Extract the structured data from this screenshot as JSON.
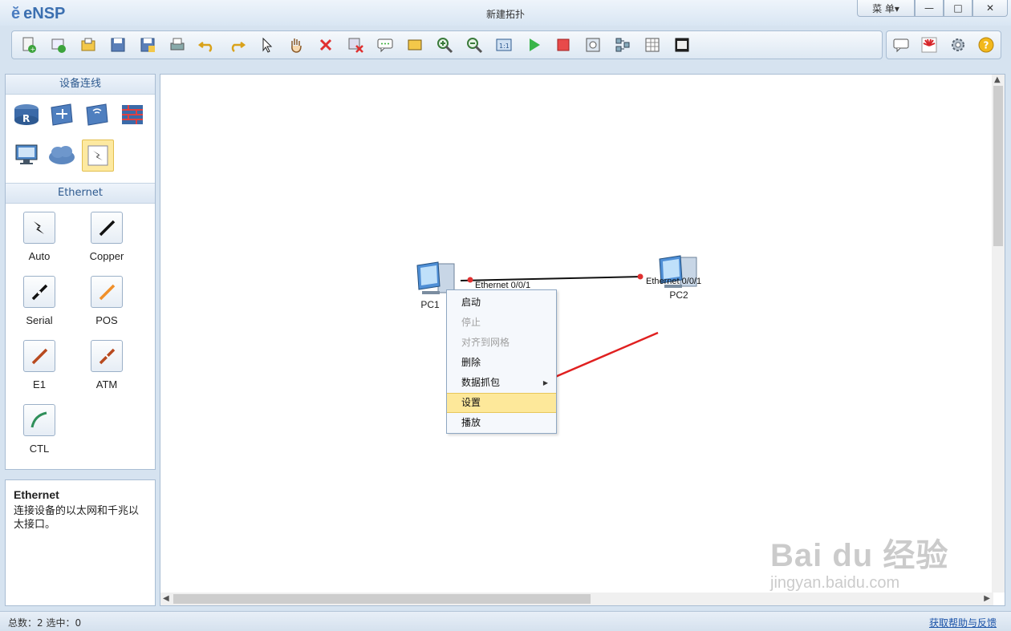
{
  "window": {
    "app_name": "eNSP",
    "title": "新建拓扑",
    "menu_label": "菜 单▾",
    "minimize": "—",
    "maximize": "□",
    "close": "✕"
  },
  "toolbar": {
    "icons": [
      "new-topology-icon",
      "new-example-icon",
      "open-icon",
      "save-icon",
      "save-as-icon",
      "print-icon",
      "undo-icon",
      "redo-icon",
      "select-icon",
      "pan-hand-icon",
      "delete-icon",
      "delete-link-icon",
      "text-annotation-icon",
      "rectangle-icon",
      "zoom-in-icon",
      "zoom-out-icon",
      "fit-view-icon",
      "start-icon",
      "stop-icon",
      "capture-icon",
      "topology-icon",
      "grid-icon",
      "screenshot-icon"
    ],
    "right_icons": [
      "chat-icon",
      "huawei-logo-icon",
      "settings-gear-icon",
      "help-icon"
    ]
  },
  "left_panel": {
    "device_header": "设备连线",
    "devices": [
      "router-icon",
      "switch-icon",
      "wireless-icon",
      "firewall-icon",
      "pc-icon",
      "cloud-icon",
      "cable-icon"
    ],
    "cable_header": "Ethernet",
    "cables": [
      {
        "label": "Auto",
        "color": "#111111",
        "icon": "auto-cable-icon"
      },
      {
        "label": "Copper",
        "color": "#111111",
        "icon": "copper-cable-icon"
      },
      {
        "label": "Serial",
        "color": "#111111",
        "icon": "serial-cable-icon"
      },
      {
        "label": "POS",
        "color": "#f0902a",
        "icon": "pos-cable-icon"
      },
      {
        "label": "E1",
        "color": "#b84a1f",
        "icon": "e1-cable-icon"
      },
      {
        "label": "ATM",
        "color": "#b84a1f",
        "icon": "atm-cable-icon"
      },
      {
        "label": "CTL",
        "color": "#2f8f5a",
        "icon": "ctl-cable-icon"
      }
    ]
  },
  "info_panel": {
    "title": "Ethernet",
    "description": "连接设备的以太网和千兆以太接口。"
  },
  "canvas": {
    "nodes": [
      {
        "label": "PC1",
        "port": "Ethernet 0/0/1"
      },
      {
        "label": "PC2",
        "port": "Ethernet 0/0/1"
      }
    ],
    "link_color": "#111111",
    "port_dot_color": "#e03030"
  },
  "context_menu": {
    "items": [
      {
        "label": "启动",
        "enabled": true
      },
      {
        "label": "停止",
        "enabled": false
      },
      {
        "label": "对齐到网格",
        "enabled": false
      },
      {
        "label": "删除",
        "enabled": true
      },
      {
        "label": "数据抓包",
        "enabled": true,
        "submenu": true
      },
      {
        "label": "设置",
        "enabled": true,
        "highlighted": true
      },
      {
        "label": "播放",
        "enabled": true
      }
    ]
  },
  "annotation": {
    "arrow_color": "#e02020"
  },
  "status": {
    "left": "总数：2  选中：0",
    "right": "获取帮助与反馈"
  },
  "watermark": {
    "line1": "Bai du 经验",
    "line2": "jingyan.baidu.com"
  }
}
